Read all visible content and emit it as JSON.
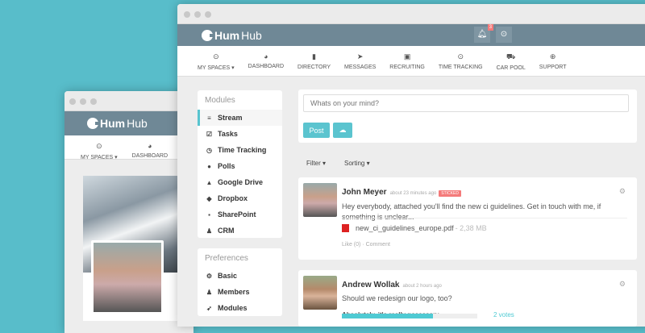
{
  "back_window": {
    "logo": {
      "mark": "Hum",
      "rest": "Hub"
    },
    "nav": [
      {
        "icon": "target-icon",
        "glyph": "⊙",
        "label": "MY SPACES ▾"
      },
      {
        "icon": "dashboard-icon",
        "glyph": "◕",
        "label": "DASHBOARD"
      }
    ]
  },
  "front_window": {
    "logo": {
      "mark": "Hum",
      "rest": "Hub"
    },
    "notification_count": "3",
    "nav": [
      {
        "icon": "target-icon",
        "glyph": "⊙",
        "label": "MY SPACES ▾"
      },
      {
        "icon": "dashboard-icon",
        "glyph": "◕",
        "label": "DASHBOARD"
      },
      {
        "icon": "book-icon",
        "glyph": "▮",
        "label": "DIRECTORY"
      },
      {
        "icon": "paper-plane-icon",
        "glyph": "➤",
        "label": "MESSAGES"
      },
      {
        "icon": "linkedin-icon",
        "glyph": "▣",
        "label": "RECRUITING"
      },
      {
        "icon": "clock-icon",
        "glyph": "⊙",
        "label": "TIME TRACKING"
      },
      {
        "icon": "car-icon",
        "glyph": "⛟",
        "label": "CAR POOL"
      },
      {
        "icon": "lifebuoy-icon",
        "glyph": "⊕",
        "label": "SUPPORT"
      }
    ],
    "modules": {
      "title": "Modules",
      "items": [
        {
          "icon": "list-icon",
          "glyph": "≡",
          "label": "Stream"
        },
        {
          "icon": "check-square-icon",
          "glyph": "☑",
          "label": "Tasks"
        },
        {
          "icon": "clock-icon",
          "glyph": "◷",
          "label": "Time Tracking"
        },
        {
          "icon": "poll-icon",
          "glyph": "●",
          "label": "Polls"
        },
        {
          "icon": "google-drive-icon",
          "glyph": "▲",
          "label": "Google Drive"
        },
        {
          "icon": "dropbox-icon",
          "glyph": "◆",
          "label": "Dropbox"
        },
        {
          "icon": "sharepoint-icon",
          "glyph": "▪",
          "label": "SharePoint"
        },
        {
          "icon": "user-icon",
          "glyph": "♟",
          "label": "CRM"
        }
      ]
    },
    "preferences": {
      "title": "Preferences",
      "items": [
        {
          "icon": "gears-icon",
          "glyph": "⚙",
          "label": "Basic"
        },
        {
          "icon": "users-icon",
          "glyph": "♟",
          "label": "Members"
        },
        {
          "icon": "rocket-icon",
          "glyph": "➶",
          "label": "Modules"
        }
      ]
    },
    "composer": {
      "placeholder": "Whats on your mind?",
      "post_label": "Post"
    },
    "filter_label": "Filter ▾",
    "sorting_label": "Sorting ▾",
    "posts": [
      {
        "author": "John Meyer",
        "time": "about 23 minutes ago",
        "badge": "STICKED",
        "text": "Hey everybody, attached you'll find the new ci guidelines. Get in touch with me, if something is unclear...",
        "file": "new_ci_guidelines_europe.pdf",
        "file_size": "- 2,38 MB",
        "like": "Like (0)",
        "comment": "· Comment"
      },
      {
        "author": "Andrew Wollak",
        "time": "about 2 hours ago",
        "text": "Should we redesign our logo, too?",
        "poll_option": "Absolutely, it's really necessary",
        "poll_percent": 67,
        "votes": "2 votes"
      }
    ],
    "colors": {
      "accent": "#5bc4cf",
      "header": "#6f8896",
      "badge": "#f47a7a"
    }
  }
}
